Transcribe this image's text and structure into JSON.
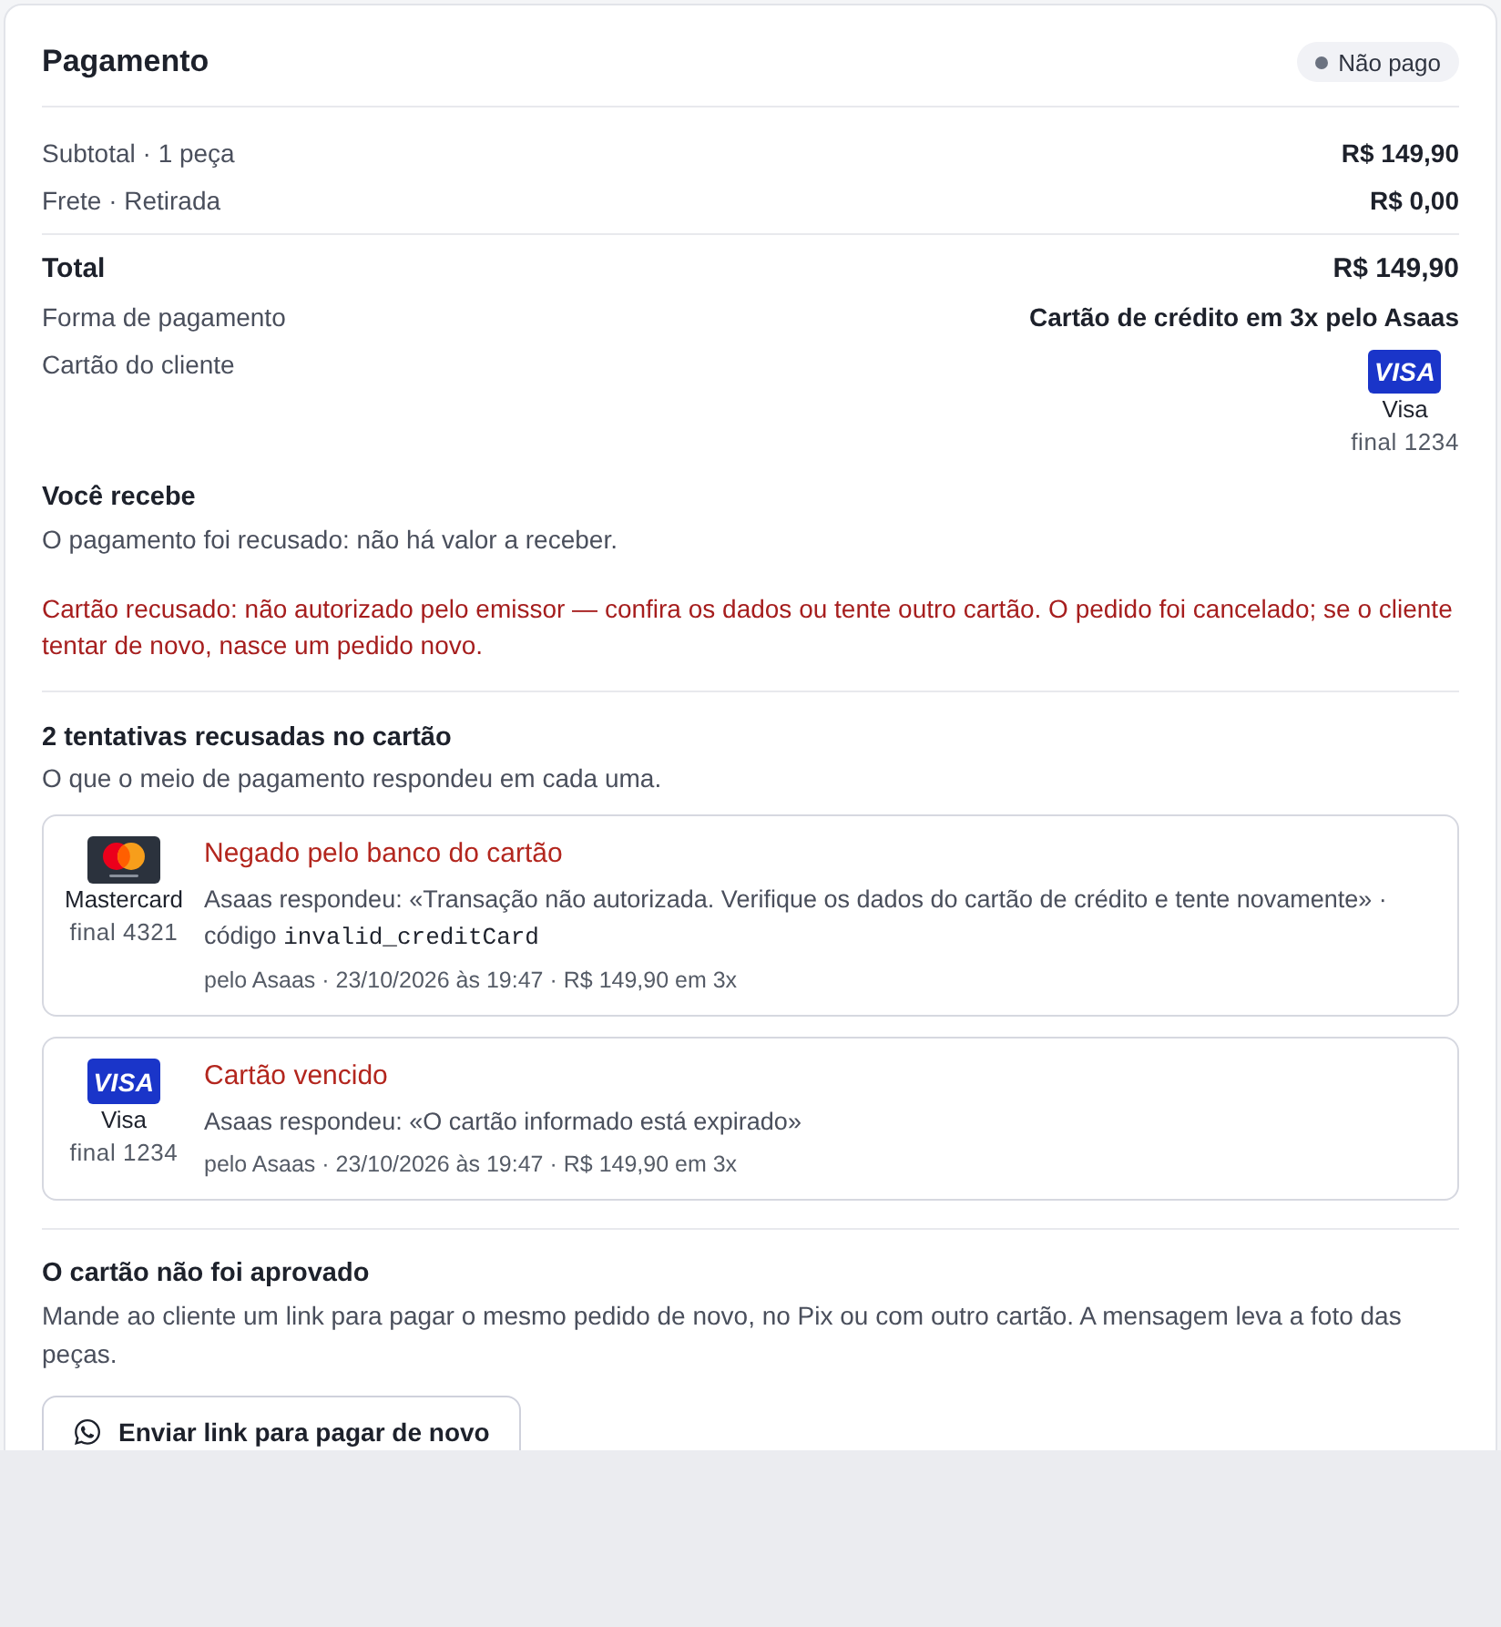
{
  "payment": {
    "title": "Pagamento",
    "status": {
      "label": "Não pago",
      "kind": "neutral"
    }
  },
  "summary": [
    {
      "label": "Subtotal · 1 peça",
      "value": "R$ 149,90"
    },
    {
      "label": "Frete · Retirada",
      "value": "R$ 0,00"
    }
  ],
  "details": [
    {
      "kind": "total",
      "label": "Total",
      "value": "R$ 149,90"
    },
    {
      "kind": "text",
      "label": "Forma de pagamento",
      "value": "Cartão de crédito em 3x pelo Asaas"
    },
    {
      "kind": "card",
      "label": "Cartão do cliente",
      "card": {
        "kind": "visa",
        "logo_text": "VISA",
        "name": "Visa",
        "number": "final 1234"
      }
    }
  ],
  "receive": {
    "title": "Você recebe",
    "text": "O pagamento foi recusado: não há valor a receber.",
    "alert": "Cartão recusado: não autorizado pelo emissor — confira os dados ou tente outro cartão. O pedido foi cancelado; se o cliente tentar de novo, nasce um pedido novo."
  },
  "attempts": {
    "title": "2 tentativas recusadas no cartão",
    "subtitle": "O que o meio de pagamento respondeu em cada uma.",
    "items": [
      {
        "card": {
          "kind": "mastercard",
          "name": "Mastercard",
          "number": "final 4321"
        },
        "title": "Negado pelo banco do cartão",
        "response": "Asaas respondeu: «Transação não autorizada. Verifique os dados do cartão de crédito e tente novamente» · código",
        "code": "invalid_creditCard",
        "meta": "pelo Asaas · 23/10/2026 às 19:47 · R$ 149,90 em 3x"
      },
      {
        "card": {
          "kind": "visa",
          "logo_text": "VISA",
          "name": "Visa",
          "number": "final 1234"
        },
        "title": "Cartão vencido",
        "response": "Asaas respondeu: «O cartão informado está expirado»",
        "meta": "pelo Asaas · 23/10/2026 às 19:47 · R$ 149,90 em 3x"
      }
    ]
  },
  "retry": {
    "title": "O cartão não foi aprovado",
    "text": "Mande ao cliente um link para pagar o mesmo pedido de novo, no Pix ou com outro cartão. A mensagem leva a foto das peças.",
    "button": "Enviar link para pagar de novo"
  }
}
